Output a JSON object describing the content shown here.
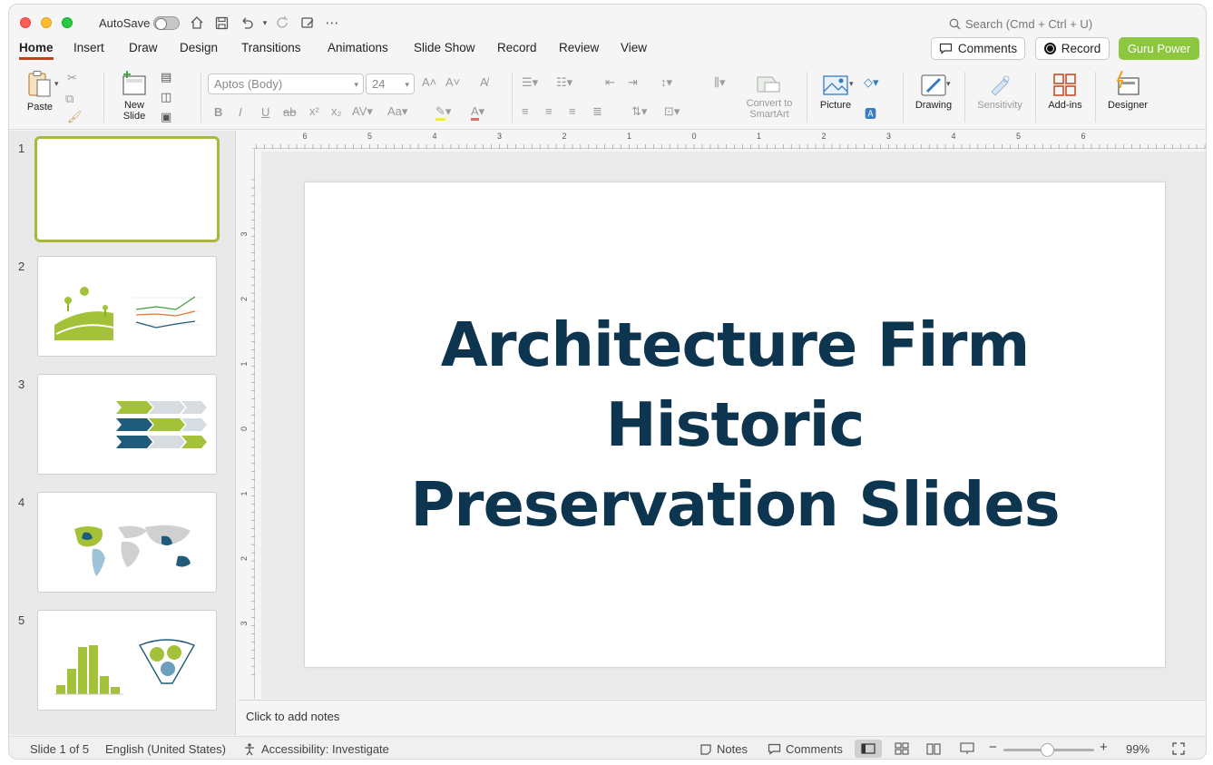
{
  "titlebar": {
    "autosave_label": "AutoSave",
    "search_placeholder": "Search (Cmd + Ctrl + U)"
  },
  "tabs": [
    {
      "label": "Home",
      "active": true
    },
    {
      "label": "Insert"
    },
    {
      "label": "Draw"
    },
    {
      "label": "Design"
    },
    {
      "label": "Transitions"
    },
    {
      "label": "Animations"
    },
    {
      "label": "Slide Show"
    },
    {
      "label": "Record"
    },
    {
      "label": "Review"
    },
    {
      "label": "View"
    }
  ],
  "header_buttons": {
    "comments": "Comments",
    "record": "Record",
    "guru": "Guru Power"
  },
  "ribbon": {
    "paste": "Paste",
    "new_slide": "New Slide",
    "font_name": "Aptos (Body)",
    "font_size": "24",
    "convert_smartart": "Convert to SmartArt",
    "picture": "Picture",
    "drawing": "Drawing",
    "sensitivity": "Sensitivity",
    "addins": "Add-ins",
    "designer": "Designer"
  },
  "slides": [
    {
      "number": "1",
      "selected": true
    },
    {
      "number": "2"
    },
    {
      "number": "3"
    },
    {
      "number": "4"
    },
    {
      "number": "5"
    }
  ],
  "slide_content": {
    "title_line1": "Architecture Firm",
    "title_line2": "Historic",
    "title_line3": "Preservation Slides",
    "title_color": "#0d3550"
  },
  "notes_placeholder": "Click to add notes",
  "status": {
    "slide_counter": "Slide 1 of 5",
    "language": "English (United States)",
    "accessibility": "Accessibility: Investigate",
    "notes": "Notes",
    "comments": "Comments",
    "zoom": "99%"
  },
  "ruler": {
    "h_labels": [
      "6",
      "5",
      "4",
      "3",
      "2",
      "1",
      "0",
      "1",
      "2",
      "3",
      "4",
      "5",
      "6"
    ],
    "v_labels": [
      "3",
      "2",
      "1",
      "0",
      "1",
      "2",
      "3"
    ]
  },
  "colors": {
    "accent_tab": "#c43e1c",
    "guru_green": "#8dc63f",
    "thumb_green": "#a3c23a",
    "thumb_blue": "#1f5b7a"
  }
}
